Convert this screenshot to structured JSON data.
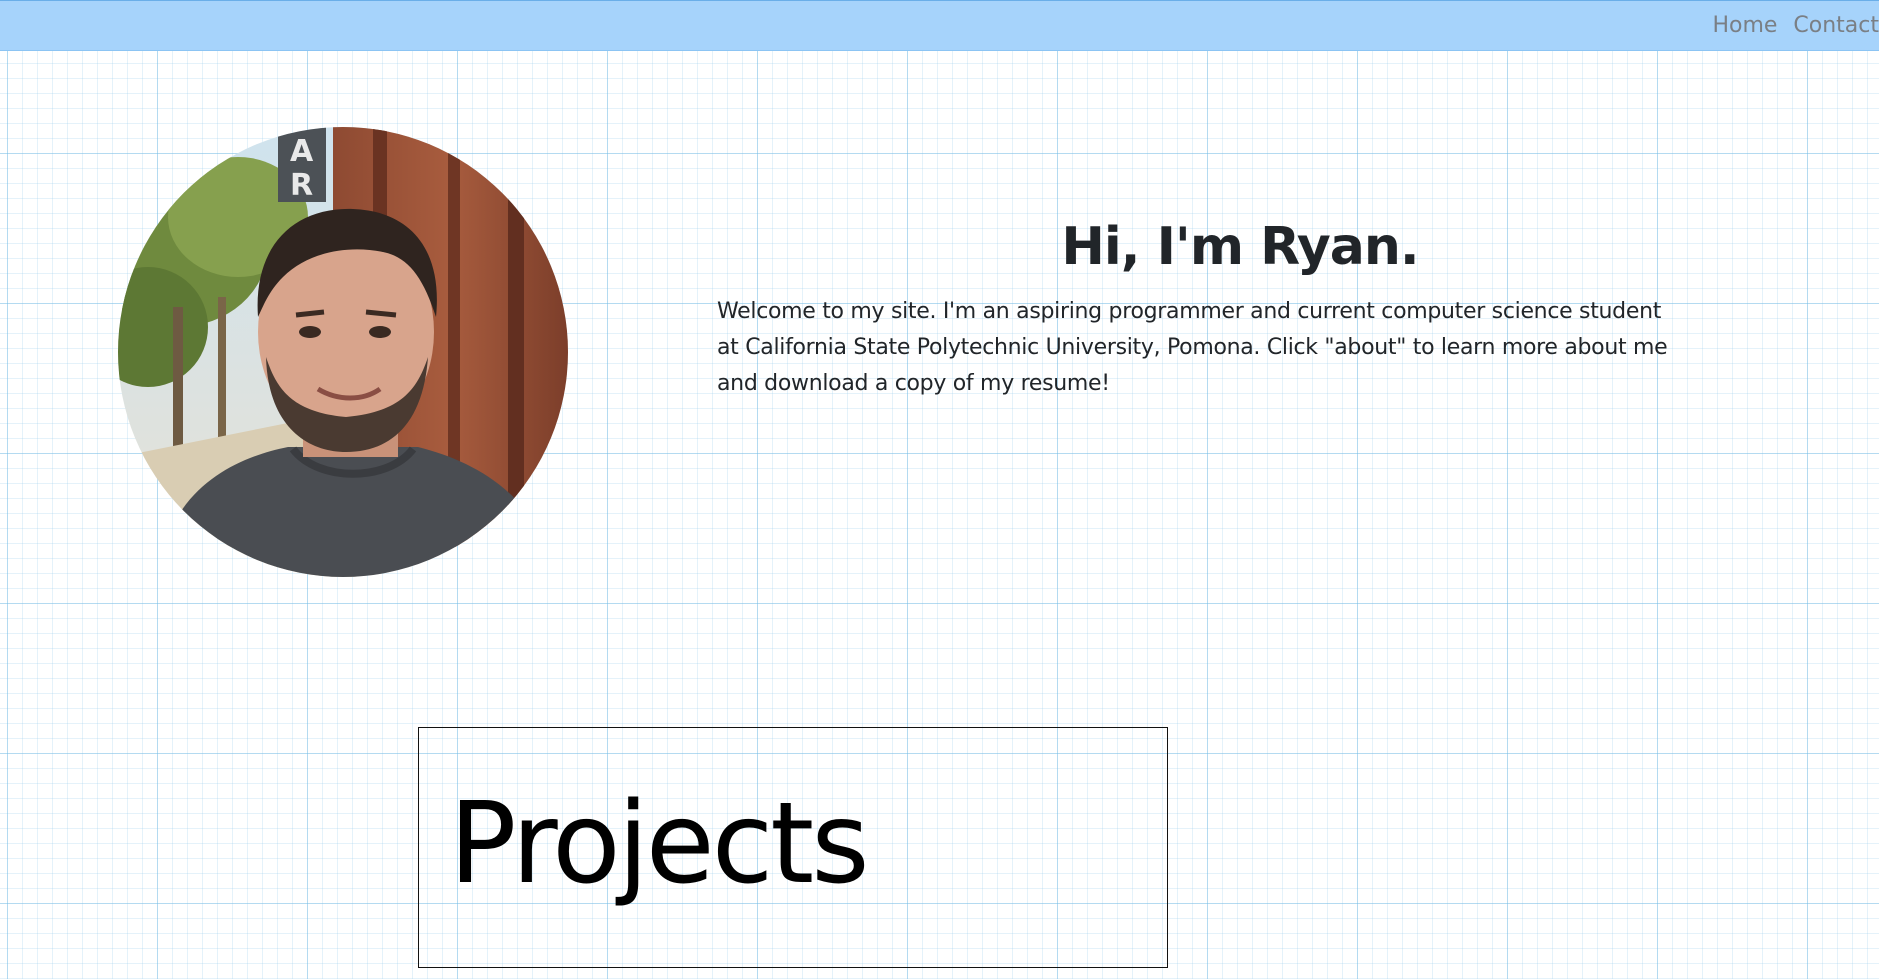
{
  "nav": {
    "home_label": "Home",
    "contact_label": "Contact"
  },
  "hero": {
    "title": "Hi, I'm Ryan.",
    "text": "Welcome to my site. I'm an aspiring programmer and current computer science student at California State Polytechnic University, Pomona. Click \"about\" to learn more about me and download a copy of my resume!",
    "avatar_alt": "Portrait photo of Ryan"
  },
  "projects": {
    "title": "Projects"
  },
  "colors": {
    "navbar": "#a6d3fb",
    "grid_lines": "#78bee6",
    "text": "#212529",
    "nav_link": "#7a7f85"
  }
}
